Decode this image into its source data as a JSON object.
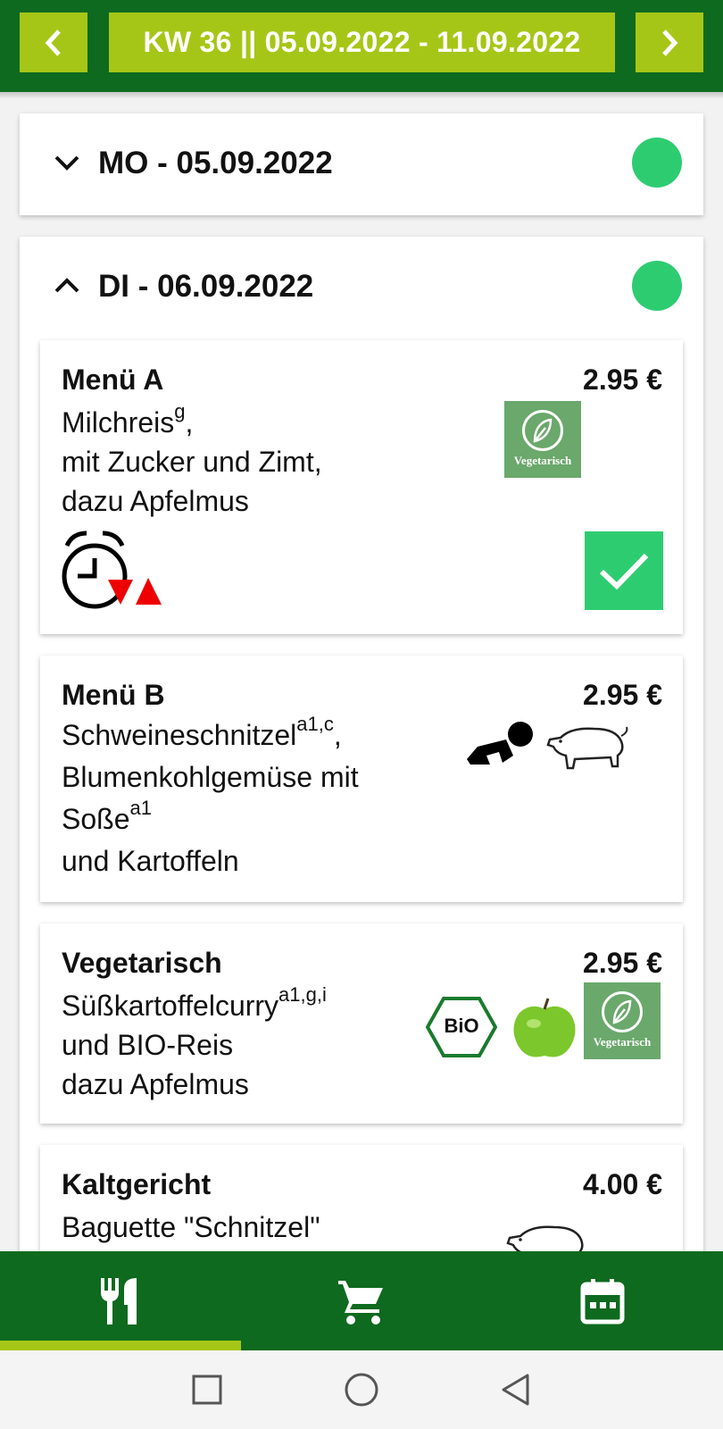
{
  "header": {
    "prev_icon": "chevron-left-icon",
    "week_label": "KW 36 || 05.09.2022 - 11.09.2022",
    "next_icon": "chevron-right-icon"
  },
  "days": [
    {
      "title": "MO - 05.09.2022",
      "expanded": false,
      "status_color": "#2ecc71"
    },
    {
      "title": "DI - 06.09.2022",
      "expanded": true,
      "status_color": "#2ecc71",
      "menus": [
        {
          "title": "Menü A",
          "price": "2.95 €",
          "lines": [
            {
              "text": "Milchreis",
              "sup": "g",
              "tail": ","
            },
            {
              "text": "mit Zucker und Zimt,"
            },
            {
              "text": "dazu Apfelmus"
            }
          ],
          "badges": [
            "vegetarian-icon"
          ],
          "badge_text": "Vegetarisch",
          "extras": [
            "alarm-clock-icon",
            "warning-triangles-icon"
          ],
          "ordered": true
        },
        {
          "title": "Menü B",
          "price": "2.95 €",
          "lines": [
            {
              "text": "Schweineschnitzel",
              "sup": "a1,c",
              "tail": ","
            },
            {
              "text": "Blumenkohlgemüse mit"
            },
            {
              "text": "Soße",
              "sup": "a1"
            },
            {
              "text": "und Kartoffeln"
            }
          ],
          "badges": [
            "child-icon",
            "pig-icon"
          ]
        },
        {
          "title": "Vegetarisch",
          "price": "2.95 €",
          "lines": [
            {
              "text": "Süßkartoffelcurry",
              "sup": "a1,g,i"
            },
            {
              "text": "und BIO-Reis"
            },
            {
              "text": "dazu Apfelmus"
            }
          ],
          "badges": [
            "bio-seal-icon",
            "apple-icon",
            "vegetarian-icon"
          ],
          "bio_text": "BiO",
          "badge_text": "Vegetarisch"
        },
        {
          "title": "Kaltgericht",
          "price": "4.00 €",
          "lines": [
            {
              "text": "Baguette \"Schnitzel\""
            }
          ],
          "badges": [
            "pig-icon"
          ]
        }
      ]
    }
  ],
  "bottom_nav": {
    "items": [
      "cutlery-icon",
      "cart-icon",
      "calendar-icon"
    ],
    "active_index": 0,
    "accent": "#a6c617",
    "background": "#0e6a1f"
  },
  "system_nav": [
    "recent-apps-icon",
    "home-icon",
    "back-icon"
  ]
}
